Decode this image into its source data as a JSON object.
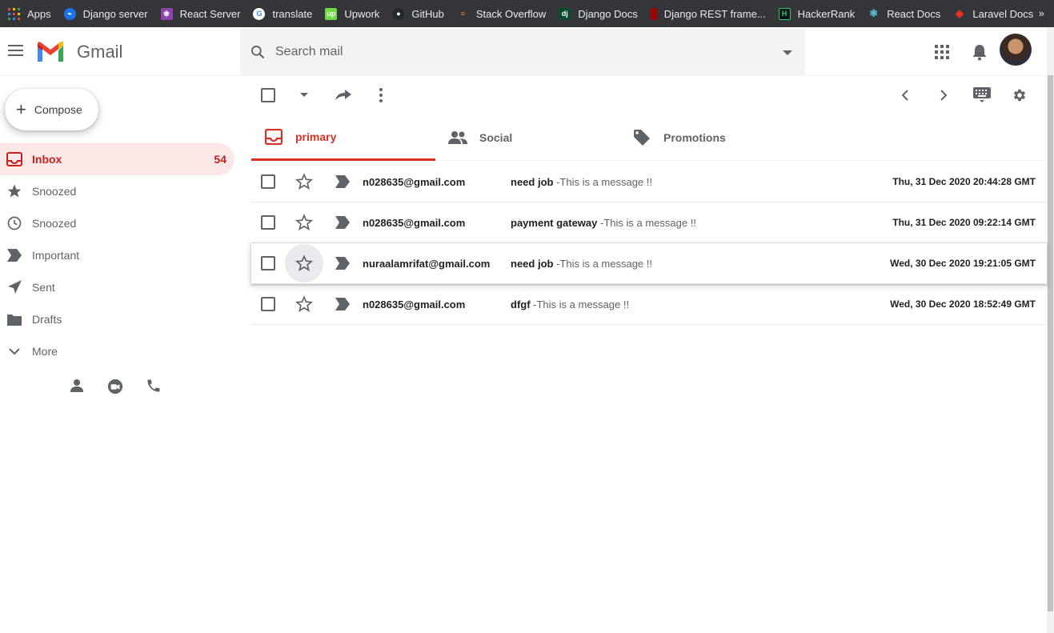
{
  "bookmarks": [
    {
      "label": "Apps",
      "icon": "apps-grid-icon",
      "color": "#e8453c"
    },
    {
      "label": "Django server",
      "icon": "django-server-icon",
      "color": "#1a73e8"
    },
    {
      "label": "React Server",
      "icon": "react-server-icon",
      "color": "#8e44ad"
    },
    {
      "label": "translate",
      "icon": "google-icon",
      "color": "#ffffff"
    },
    {
      "label": "Upwork",
      "icon": "upwork-icon",
      "color": "#6fda44"
    },
    {
      "label": "GitHub",
      "icon": "github-icon",
      "color": "#24292e"
    },
    {
      "label": "Stack Overflow",
      "icon": "stackoverflow-icon",
      "color": "#f48024"
    },
    {
      "label": "Django Docs",
      "icon": "django-icon",
      "color": "#0c4b33"
    },
    {
      "label": "Django REST frame...",
      "icon": "drf-icon",
      "color": "#a30000"
    },
    {
      "label": "HackerRank",
      "icon": "hackerrank-icon",
      "color": "#0e141e"
    },
    {
      "label": "React Docs",
      "icon": "react-icon",
      "color": "#61dafb"
    },
    {
      "label": "Laravel Docs",
      "icon": "laravel-icon",
      "color": "#ff2d20"
    }
  ],
  "header": {
    "app_name": "Gmail",
    "search_placeholder": "Search mail"
  },
  "compose_label": "Compose",
  "nav": [
    {
      "label": "Inbox",
      "icon": "inbox-icon",
      "count": "54",
      "active": true
    },
    {
      "label": "Snoozed",
      "icon": "star-filled-icon",
      "count": ""
    },
    {
      "label": "Snoozed",
      "icon": "clock-icon",
      "count": ""
    },
    {
      "label": "Important",
      "icon": "important-icon",
      "count": ""
    },
    {
      "label": "Sent",
      "icon": "send-icon",
      "count": ""
    },
    {
      "label": "Drafts",
      "icon": "draft-icon",
      "count": ""
    },
    {
      "label": "More",
      "icon": "chevron-down-icon",
      "count": ""
    }
  ],
  "tabs": [
    {
      "label": "primary",
      "icon": "inbox-tab-icon",
      "active": true
    },
    {
      "label": "Social",
      "icon": "people-icon",
      "active": false
    },
    {
      "label": "Promotions",
      "icon": "tag-icon",
      "active": false
    }
  ],
  "emails": [
    {
      "sender": "n028635@gmail.com",
      "subject": "need job",
      "snippet": " -This is a message !!",
      "date": "Thu, 31 Dec 2020 20:44:28 GMT"
    },
    {
      "sender": "n028635@gmail.com",
      "subject": "payment gateway",
      "snippet": " -This is a message !!",
      "date": "Thu, 31 Dec 2020 09:22:14 GMT"
    },
    {
      "sender": "nuraalamrifat@gmail.com",
      "subject": "need job",
      "snippet": " -This is a message !!",
      "date": "Wed, 30 Dec 2020 19:21:05 GMT"
    },
    {
      "sender": "n028635@gmail.com",
      "subject": "dfgf",
      "snippet": " -This is a message !!",
      "date": "Wed, 30 Dec 2020 18:52:49 GMT"
    }
  ],
  "colors": {
    "accent": "#d93025",
    "active_bg": "#fce8e6",
    "bookmarks_bg": "#35363a"
  }
}
